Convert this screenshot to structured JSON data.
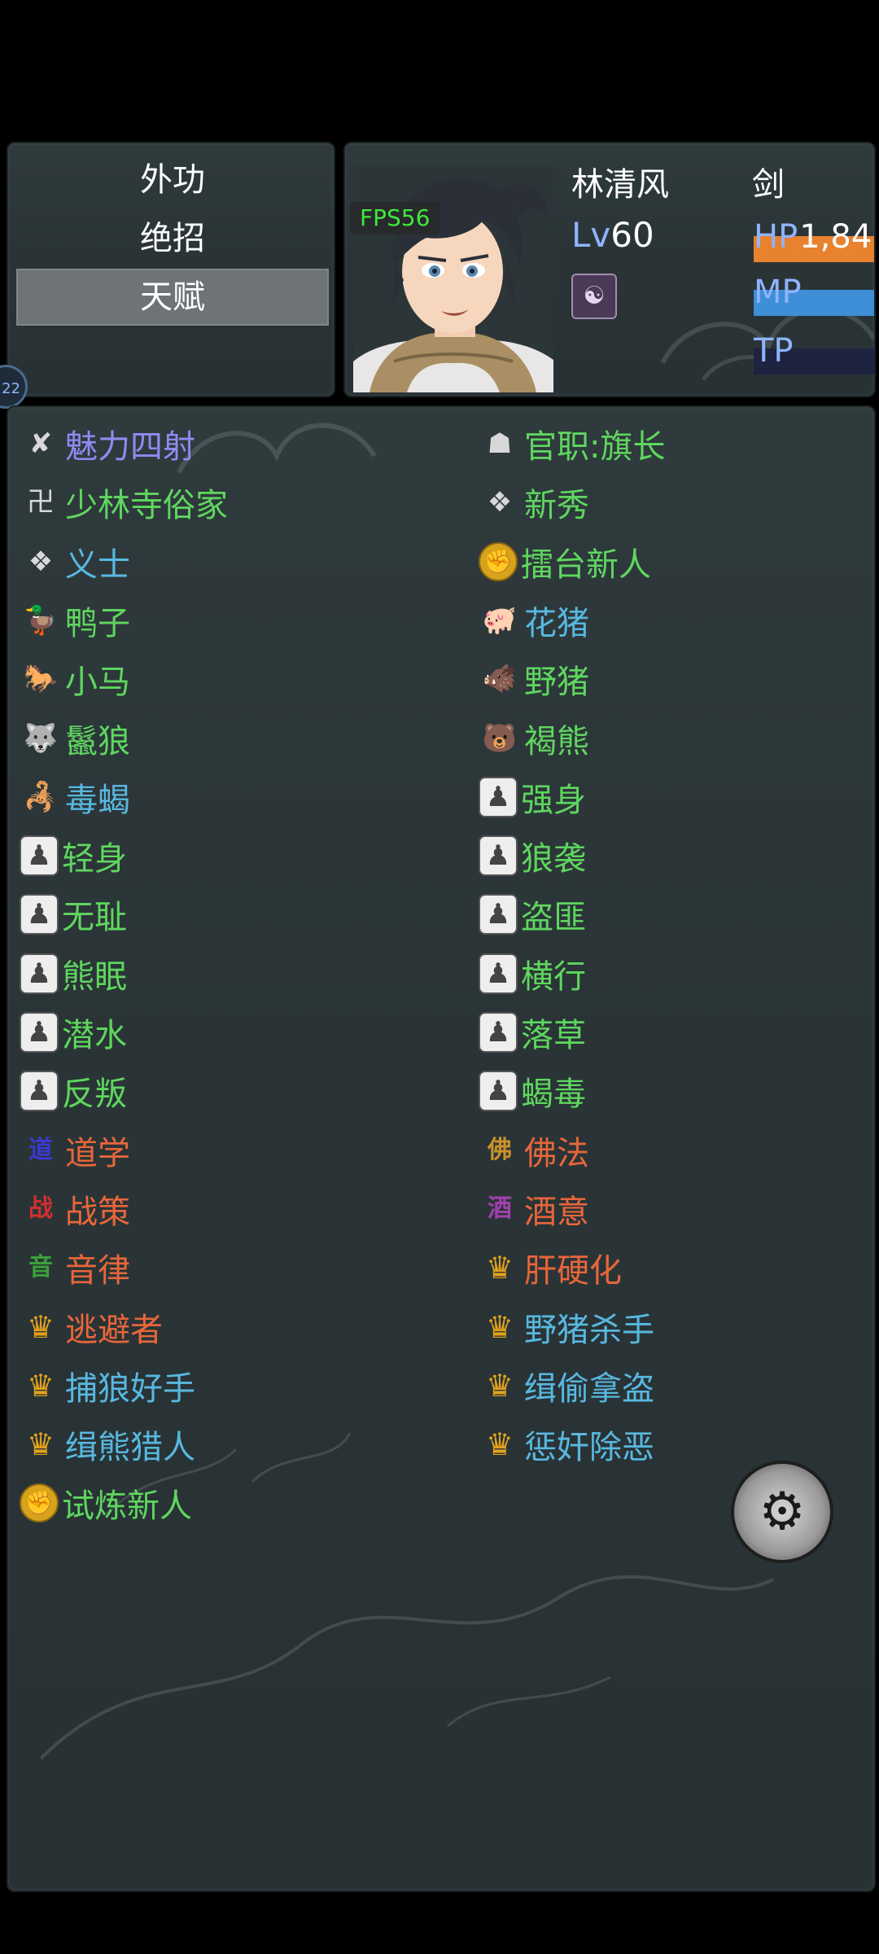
{
  "menu": {
    "items": [
      {
        "label": "外功",
        "selected": false
      },
      {
        "label": "绝招",
        "selected": false
      },
      {
        "label": "天赋",
        "selected": true
      }
    ]
  },
  "status": {
    "fps": "FPS56",
    "name": "林清风",
    "weapon": "剑",
    "level_label": "Lv",
    "level_value": "60",
    "state_icon": "meditation-icon",
    "hp": {
      "label": "HP",
      "value": "1,84",
      "color": "#e8822e",
      "fill_fraction": 1.0
    },
    "mp": {
      "label": "MP",
      "color": "#3e8ed8",
      "fill_fraction": 1.0
    },
    "tp": {
      "label": "TP",
      "color": "#1e2440",
      "fill_fraction": 0.0
    }
  },
  "side_tab_label": "22",
  "talents": {
    "left": [
      {
        "label": "魅力四射",
        "color": "#8d8cf2",
        "icon": "charm-icon",
        "glyph": "✘",
        "style": "plain"
      },
      {
        "label": "少林寺俗家",
        "color": "#5fd65f",
        "icon": "swastika-icon",
        "glyph": "卍",
        "style": "plain"
      },
      {
        "label": "义士",
        "color": "#58b8e0",
        "icon": "hero-badge-icon",
        "glyph": "❖",
        "style": "plain"
      },
      {
        "label": "鸭子",
        "color": "#5fd65f",
        "icon": "duck-icon",
        "glyph": "🦆",
        "style": "plain"
      },
      {
        "label": "小马",
        "color": "#5fd65f",
        "icon": "horse-icon",
        "glyph": "🐎",
        "style": "plain"
      },
      {
        "label": "鬣狼",
        "color": "#5fd65f",
        "icon": "wolf-icon",
        "glyph": "🐺",
        "style": "plain"
      },
      {
        "label": "毒蝎",
        "color": "#58b8e0",
        "icon": "scorpion-icon",
        "glyph": "🦂",
        "style": "plain"
      },
      {
        "label": "轻身",
        "color": "#5fd65f",
        "icon": "locked-silhouette-icon",
        "glyph": "♟",
        "style": "locked"
      },
      {
        "label": "无耻",
        "color": "#5fd65f",
        "icon": "locked-silhouette-icon",
        "glyph": "♟",
        "style": "locked"
      },
      {
        "label": "熊眠",
        "color": "#5fd65f",
        "icon": "locked-silhouette-icon",
        "glyph": "♟",
        "style": "locked"
      },
      {
        "label": "潜水",
        "color": "#5fd65f",
        "icon": "locked-silhouette-icon",
        "glyph": "♟",
        "style": "locked"
      },
      {
        "label": "反叛",
        "color": "#5fd65f",
        "icon": "locked-silhouette-icon",
        "glyph": "♟",
        "style": "locked"
      },
      {
        "label": "道学",
        "color": "#e8663a",
        "icon": "dao-icon",
        "glyph": "道",
        "style": "glyph",
        "glyph_color": "#3a3acf"
      },
      {
        "label": "战策",
        "color": "#e8663a",
        "icon": "strategy-icon",
        "glyph": "战",
        "style": "glyph",
        "glyph_color": "#d03030"
      },
      {
        "label": "音律",
        "color": "#e8663a",
        "icon": "music-icon",
        "glyph": "音",
        "style": "glyph",
        "glyph_color": "#3aa03a"
      },
      {
        "label": "逃避者",
        "color": "#e8663a",
        "icon": "crown-icon",
        "glyph": "♛",
        "style": "crown"
      },
      {
        "label": "捕狼好手",
        "color": "#58b8e0",
        "icon": "crown-icon",
        "glyph": "♛",
        "style": "crown"
      },
      {
        "label": "缉熊猎人",
        "color": "#58b8e0",
        "icon": "crown-icon",
        "glyph": "♛",
        "style": "crown"
      },
      {
        "label": "试炼新人",
        "color": "#5fd65f",
        "icon": "fist-icon",
        "glyph": "✊",
        "style": "fist"
      }
    ],
    "right": [
      {
        "label": "官职:旗长",
        "color": "#5fd65f",
        "icon": "official-hat-icon",
        "glyph": "☗",
        "style": "plain"
      },
      {
        "label": "新秀",
        "color": "#5fd65f",
        "icon": "rookie-badge-icon",
        "glyph": "❖",
        "style": "plain"
      },
      {
        "label": "擂台新人",
        "color": "#5fd65f",
        "icon": "fist-icon",
        "glyph": "✊",
        "style": "fist"
      },
      {
        "label": "花猪",
        "color": "#58b8e0",
        "icon": "pig-icon",
        "glyph": "🐖",
        "style": "plain"
      },
      {
        "label": "野猪",
        "color": "#5fd65f",
        "icon": "boar-icon",
        "glyph": "🐗",
        "style": "plain"
      },
      {
        "label": "褐熊",
        "color": "#5fd65f",
        "icon": "bear-icon",
        "glyph": "🐻",
        "style": "plain"
      },
      {
        "label": "强身",
        "color": "#5fd65f",
        "icon": "locked-silhouette-icon",
        "glyph": "♟",
        "style": "locked"
      },
      {
        "label": "狼袭",
        "color": "#5fd65f",
        "icon": "locked-silhouette-icon",
        "glyph": "♟",
        "style": "locked"
      },
      {
        "label": "盗匪",
        "color": "#5fd65f",
        "icon": "locked-silhouette-icon",
        "glyph": "♟",
        "style": "locked"
      },
      {
        "label": "横行",
        "color": "#5fd65f",
        "icon": "locked-silhouette-icon",
        "glyph": "♟",
        "style": "locked"
      },
      {
        "label": "落草",
        "color": "#5fd65f",
        "icon": "locked-silhouette-icon",
        "glyph": "♟",
        "style": "locked"
      },
      {
        "label": "蝎毒",
        "color": "#5fd65f",
        "icon": "locked-silhouette-icon",
        "glyph": "♟",
        "style": "locked"
      },
      {
        "label": "佛法",
        "color": "#e8663a",
        "icon": "buddha-icon",
        "glyph": "佛",
        "style": "glyph",
        "glyph_color": "#c8922a"
      },
      {
        "label": "酒意",
        "color": "#e8663a",
        "icon": "wine-icon",
        "glyph": "酒",
        "style": "glyph",
        "glyph_color": "#a040b0"
      },
      {
        "label": "肝硬化",
        "color": "#e8663a",
        "icon": "crown-icon",
        "glyph": "♛",
        "style": "crown"
      },
      {
        "label": "野猪杀手",
        "color": "#58b8e0",
        "icon": "crown-icon",
        "glyph": "♛",
        "style": "crown"
      },
      {
        "label": "缉偷拿盗",
        "color": "#58b8e0",
        "icon": "crown-icon",
        "glyph": "♛",
        "style": "crown"
      },
      {
        "label": "惩奸除恶",
        "color": "#58b8e0",
        "icon": "crown-icon",
        "glyph": "♛",
        "style": "crown"
      }
    ]
  },
  "settings_icon": "gear-back-icon"
}
